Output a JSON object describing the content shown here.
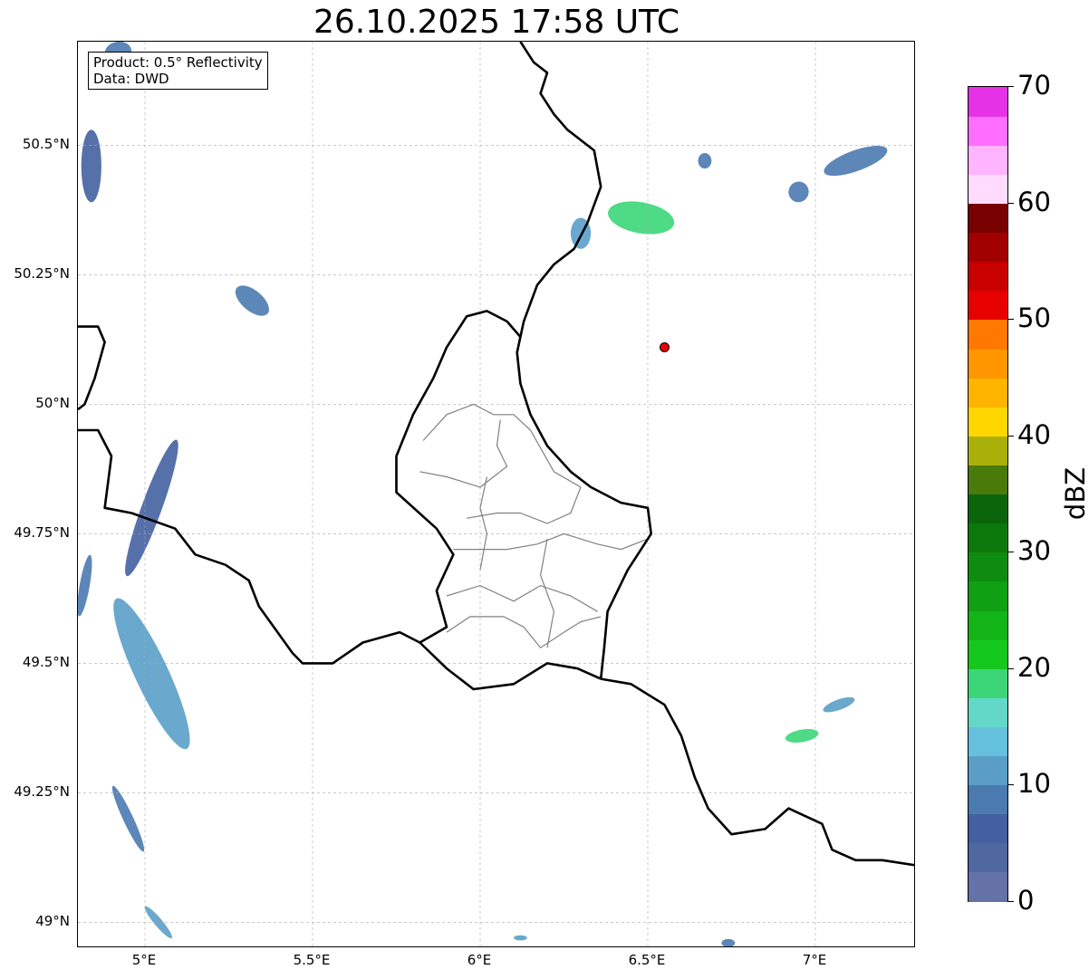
{
  "title": "26.10.2025 17:58 UTC",
  "info": {
    "product": "Product: 0.5° Reflectivity",
    "data": "Data: DWD"
  },
  "map": {
    "lon_range": [
      4.8,
      7.3
    ],
    "lat_range": [
      48.95,
      50.7
    ],
    "lat_ticks": [
      {
        "value": 50.5,
        "label": "50.5°N"
      },
      {
        "value": 50.25,
        "label": "50.25°N"
      },
      {
        "value": 50.0,
        "label": "50°N"
      },
      {
        "value": 49.75,
        "label": "49.75°N"
      },
      {
        "value": 49.5,
        "label": "49.5°N"
      },
      {
        "value": 49.25,
        "label": "49.25°N"
      },
      {
        "value": 49.0,
        "label": "49°N"
      }
    ],
    "lon_ticks": [
      {
        "value": 5.0,
        "label": "5°E"
      },
      {
        "value": 5.5,
        "label": "5.5°E"
      },
      {
        "value": 6.0,
        "label": "6°E"
      },
      {
        "value": 6.5,
        "label": "6.5°E"
      },
      {
        "value": 7.0,
        "label": "7°E"
      }
    ],
    "grid": true,
    "radar_site": {
      "lon": 6.55,
      "lat": 50.11,
      "color": "#e8000b"
    }
  },
  "colorbar": {
    "label": "dBZ",
    "ticks": [
      {
        "value": 0,
        "label": "0"
      },
      {
        "value": 10,
        "label": "10"
      },
      {
        "value": 20,
        "label": "20"
      },
      {
        "value": 30,
        "label": "30"
      },
      {
        "value": 40,
        "label": "40"
      },
      {
        "value": 50,
        "label": "50"
      },
      {
        "value": 60,
        "label": "60"
      },
      {
        "value": 70,
        "label": "70"
      }
    ],
    "range": [
      0,
      70
    ],
    "colors": [
      "#6472a8",
      "#5068a0",
      "#4460a0",
      "#4a7ab0",
      "#5a9ec8",
      "#64c0dc",
      "#64d8c8",
      "#3cd678",
      "#14c81e",
      "#12b418",
      "#10a014",
      "#0e8c10",
      "#0c780c",
      "#0a640a",
      "#4a7a0a",
      "#aab00a",
      "#ffd700",
      "#ffb400",
      "#ff9600",
      "#ff7800",
      "#e60000",
      "#c80000",
      "#a00000",
      "#780000",
      "#ffdcff",
      "#ffb4ff",
      "#ff6eff",
      "#e632e6"
    ]
  },
  "echoes": [
    {
      "lon": 4.92,
      "lat": 50.68,
      "rx": 0.04,
      "ry": 0.02,
      "rot": -10,
      "color": "#4a7ab0"
    },
    {
      "lon": 4.84,
      "lat": 50.46,
      "rx": 0.03,
      "ry": 0.07,
      "rot": 0,
      "color": "#4460a0"
    },
    {
      "lon": 5.32,
      "lat": 50.2,
      "rx": 0.06,
      "ry": 0.02,
      "rot": 40,
      "color": "#4a7ab0"
    },
    {
      "lon": 5.02,
      "lat": 49.8,
      "rx": 0.03,
      "ry": 0.14,
      "rot": 20,
      "color": "#4460a0"
    },
    {
      "lon": 4.82,
      "lat": 49.65,
      "rx": 0.015,
      "ry": 0.06,
      "rot": 10,
      "color": "#4a7ab0"
    },
    {
      "lon": 5.02,
      "lat": 49.48,
      "rx": 0.05,
      "ry": 0.16,
      "rot": -25,
      "color": "#5a9ec8"
    },
    {
      "lon": 4.95,
      "lat": 49.2,
      "rx": 0.015,
      "ry": 0.07,
      "rot": -25,
      "color": "#4a7ab0"
    },
    {
      "lon": 5.04,
      "lat": 49.0,
      "rx": 0.012,
      "ry": 0.04,
      "rot": -40,
      "color": "#5a9ec8"
    },
    {
      "lon": 6.3,
      "lat": 50.33,
      "rx": 0.03,
      "ry": 0.03,
      "rot": 0,
      "color": "#5a9ec8"
    },
    {
      "lon": 6.48,
      "lat": 50.36,
      "rx": 0.1,
      "ry": 0.03,
      "rot": 10,
      "color": "#3cd678"
    },
    {
      "lon": 6.67,
      "lat": 50.47,
      "rx": 0.02,
      "ry": 0.015,
      "rot": 0,
      "color": "#4a7ab0"
    },
    {
      "lon": 6.95,
      "lat": 50.41,
      "rx": 0.03,
      "ry": 0.02,
      "rot": 20,
      "color": "#4a7ab0"
    },
    {
      "lon": 7.12,
      "lat": 50.47,
      "rx": 0.1,
      "ry": 0.02,
      "rot": -20,
      "color": "#4a7ab0"
    },
    {
      "lon": 6.96,
      "lat": 49.36,
      "rx": 0.05,
      "ry": 0.012,
      "rot": -10,
      "color": "#3cd678"
    },
    {
      "lon": 7.07,
      "lat": 49.42,
      "rx": 0.05,
      "ry": 0.01,
      "rot": -20,
      "color": "#5a9ec8"
    },
    {
      "lon": 6.74,
      "lat": 48.96,
      "rx": 0.02,
      "ry": 0.008,
      "rot": 0,
      "color": "#4a7ab0"
    },
    {
      "lon": 6.12,
      "lat": 48.97,
      "rx": 0.02,
      "ry": 0.005,
      "rot": 0,
      "color": "#5a9ec8"
    }
  ],
  "borders": {
    "country": [
      [
        [
          6.12,
          50.7
        ],
        [
          6.16,
          50.66
        ],
        [
          6.2,
          50.64
        ],
        [
          6.18,
          50.6
        ],
        [
          6.22,
          50.56
        ],
        [
          6.26,
          50.53
        ],
        [
          6.34,
          50.49
        ],
        [
          6.36,
          50.42
        ],
        [
          6.32,
          50.35
        ],
        [
          6.28,
          50.3
        ],
        [
          6.22,
          50.27
        ],
        [
          6.17,
          50.23
        ],
        [
          6.13,
          50.16
        ],
        [
          6.11,
          50.1
        ],
        [
          6.12,
          50.04
        ],
        [
          6.15,
          49.98
        ],
        [
          6.2,
          49.92
        ],
        [
          6.27,
          49.87
        ],
        [
          6.33,
          49.84
        ],
        [
          6.42,
          49.81
        ],
        [
          6.5,
          49.8
        ],
        [
          6.51,
          49.75
        ],
        [
          6.44,
          49.68
        ],
        [
          6.38,
          49.6
        ],
        [
          6.37,
          49.53
        ],
        [
          6.36,
          49.47
        ]
      ],
      [
        [
          6.36,
          49.47
        ],
        [
          6.45,
          49.46
        ],
        [
          6.55,
          49.42
        ],
        [
          6.6,
          49.36
        ],
        [
          6.64,
          49.28
        ],
        [
          6.68,
          49.22
        ],
        [
          6.75,
          49.17
        ],
        [
          6.85,
          49.18
        ],
        [
          6.92,
          49.22
        ],
        [
          7.02,
          49.19
        ],
        [
          7.05,
          49.14
        ],
        [
          7.12,
          49.12
        ],
        [
          7.2,
          49.12
        ],
        [
          7.3,
          49.11
        ]
      ],
      [
        [
          4.8,
          50.15
        ],
        [
          4.86,
          50.15
        ],
        [
          4.88,
          50.12
        ],
        [
          4.85,
          50.05
        ],
        [
          4.82,
          50.0
        ],
        [
          4.8,
          49.99
        ]
      ],
      [
        [
          4.8,
          49.95
        ],
        [
          4.86,
          49.95
        ],
        [
          4.9,
          49.9
        ],
        [
          4.88,
          49.8
        ],
        [
          4.96,
          49.79
        ],
        [
          5.09,
          49.76
        ],
        [
          5.15,
          49.71
        ],
        [
          5.24,
          49.69
        ],
        [
          5.31,
          49.66
        ],
        [
          5.34,
          49.61
        ],
        [
          5.44,
          49.52
        ],
        [
          5.47,
          49.5
        ],
        [
          5.56,
          49.5
        ],
        [
          5.65,
          49.54
        ],
        [
          5.76,
          49.56
        ],
        [
          5.82,
          49.54
        ],
        [
          5.9,
          49.49
        ],
        [
          5.98,
          49.45
        ],
        [
          6.1,
          49.46
        ],
        [
          6.2,
          49.5
        ],
        [
          6.29,
          49.49
        ],
        [
          6.36,
          49.47
        ]
      ],
      [
        [
          5.82,
          49.54
        ],
        [
          5.9,
          49.57
        ],
        [
          5.87,
          49.64
        ],
        [
          5.92,
          49.71
        ],
        [
          5.87,
          49.76
        ],
        [
          5.75,
          49.83
        ],
        [
          5.75,
          49.9
        ],
        [
          5.8,
          49.98
        ],
        [
          5.86,
          50.05
        ],
        [
          5.9,
          50.11
        ],
        [
          5.96,
          50.17
        ],
        [
          6.02,
          50.18
        ],
        [
          6.08,
          50.16
        ],
        [
          6.12,
          50.13
        ]
      ]
    ],
    "admin": [
      [
        [
          5.83,
          49.93
        ],
        [
          5.9,
          49.98
        ],
        [
          5.98,
          50.0
        ],
        [
          6.04,
          49.98
        ],
        [
          6.1,
          49.98
        ],
        [
          6.15,
          49.95
        ],
        [
          6.22,
          49.87
        ],
        [
          6.3,
          49.84
        ]
      ],
      [
        [
          5.82,
          49.87
        ],
        [
          5.9,
          49.86
        ],
        [
          6.0,
          49.84
        ],
        [
          6.08,
          49.88
        ],
        [
          6.05,
          49.92
        ],
        [
          6.06,
          49.97
        ]
      ],
      [
        [
          5.96,
          49.78
        ],
        [
          6.05,
          49.79
        ],
        [
          6.12,
          49.79
        ],
        [
          6.2,
          49.77
        ],
        [
          6.27,
          49.79
        ],
        [
          6.3,
          49.84
        ]
      ],
      [
        [
          5.92,
          49.72
        ],
        [
          6.0,
          49.72
        ],
        [
          6.08,
          49.72
        ],
        [
          6.17,
          49.73
        ],
        [
          6.25,
          49.75
        ],
        [
          6.35,
          49.73
        ],
        [
          6.42,
          49.72
        ],
        [
          6.5,
          49.74
        ]
      ],
      [
        [
          5.9,
          49.63
        ],
        [
          6.0,
          49.65
        ],
        [
          6.1,
          49.62
        ],
        [
          6.18,
          49.65
        ],
        [
          6.27,
          49.63
        ],
        [
          6.35,
          49.6
        ]
      ],
      [
        [
          5.9,
          49.56
        ],
        [
          5.97,
          49.59
        ],
        [
          6.07,
          49.59
        ],
        [
          6.13,
          49.57
        ],
        [
          6.18,
          49.53
        ],
        [
          6.25,
          49.56
        ],
        [
          6.3,
          49.58
        ],
        [
          6.36,
          49.59
        ]
      ],
      [
        [
          6.0,
          49.68
        ],
        [
          6.02,
          49.75
        ],
        [
          6.0,
          49.8
        ],
        [
          6.02,
          49.86
        ]
      ],
      [
        [
          6.2,
          49.53
        ],
        [
          6.22,
          49.6
        ],
        [
          6.18,
          49.67
        ],
        [
          6.2,
          49.74
        ]
      ]
    ]
  }
}
